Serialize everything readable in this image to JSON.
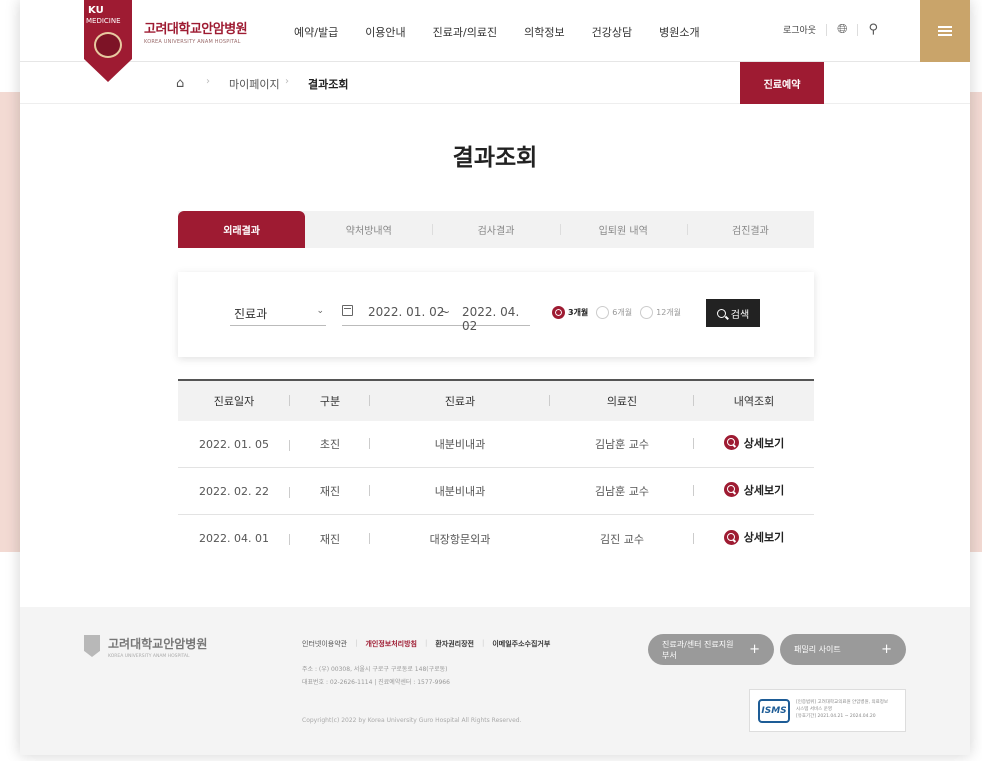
{
  "header": {
    "logo": {
      "ku": "KU",
      "medicine": "MEDICINE"
    },
    "brand_ko": "고려대학교안암병원",
    "brand_en": "KOREA UNIVERSITY ANAM HOSPITAL",
    "nav": [
      "예약/발급",
      "이용안내",
      "진료과/의료진",
      "의학정보",
      "건강상담",
      "병원소개"
    ],
    "logout": "로그아웃",
    "globe_icon": "globe-icon",
    "search_icon": "search-icon",
    "menu_icon": "hamburger-icon"
  },
  "breadcrumb": {
    "items": [
      "마이페이지",
      "결과조회"
    ],
    "reserve_btn": "진료예약"
  },
  "page_title": "결과조회",
  "tabs": [
    "외래결과",
    "약처방내역",
    "검사결과",
    "입퇴원 내역",
    "검진결과"
  ],
  "search": {
    "dept_label": "진료과",
    "date_from": "2022. 01. 02",
    "tilde": "~",
    "date_to": "2022. 04. 02",
    "periods": [
      "3개월",
      "6개월",
      "12개월"
    ],
    "selected_period": "3개월",
    "button": "검색"
  },
  "table": {
    "headers": [
      "진료일자",
      "구분",
      "진료과",
      "의료진",
      "내역조회"
    ],
    "rows": [
      {
        "date": "2022. 01. 05",
        "type": "초진",
        "dept": "내분비내과",
        "doctor": "김남훈 교수",
        "action": "상세보기"
      },
      {
        "date": "2022. 02. 22",
        "type": "재진",
        "dept": "내분비내과",
        "doctor": "김남훈 교수",
        "action": "상세보기"
      },
      {
        "date": "2022. 04. 01",
        "type": "재진",
        "dept": "대장항문외과",
        "doctor": "김진 교수",
        "action": "상세보기"
      }
    ]
  },
  "footer": {
    "brand_ko": "고려대학교안암병원",
    "brand_en": "KOREA UNIVERSITY ANAM HOSPITAL",
    "links": [
      "인터넷이용약관",
      "개인정보처리방침",
      "환자권리장전",
      "이메일주소수집거부"
    ],
    "address": "주소 : (우) 00308, 서울시 구로구 구로동로 148(구로동)",
    "phone": "대표번호 : 02-2626-1114  |  진료예약센터 : 1577-9966",
    "copyright": "Copyright(c) 2022 by Korea University Guro Hospital All Rights Reserved.",
    "btn1": "진료과/센터 진료지원부서",
    "btn2": "패밀리 사이트",
    "plus": "+",
    "isms_logo": "ISMS",
    "isms_text": [
      "[인증범위] 고려대학교의료원 안암병원, 의료정보",
      "시스템 서비스 운영",
      "[유효기간] 2021.04.21 ~ 2024.04.20"
    ]
  },
  "colors": {
    "brand": "#9e1b32",
    "gold": "#c9a46a",
    "band": "#f3dad3"
  }
}
